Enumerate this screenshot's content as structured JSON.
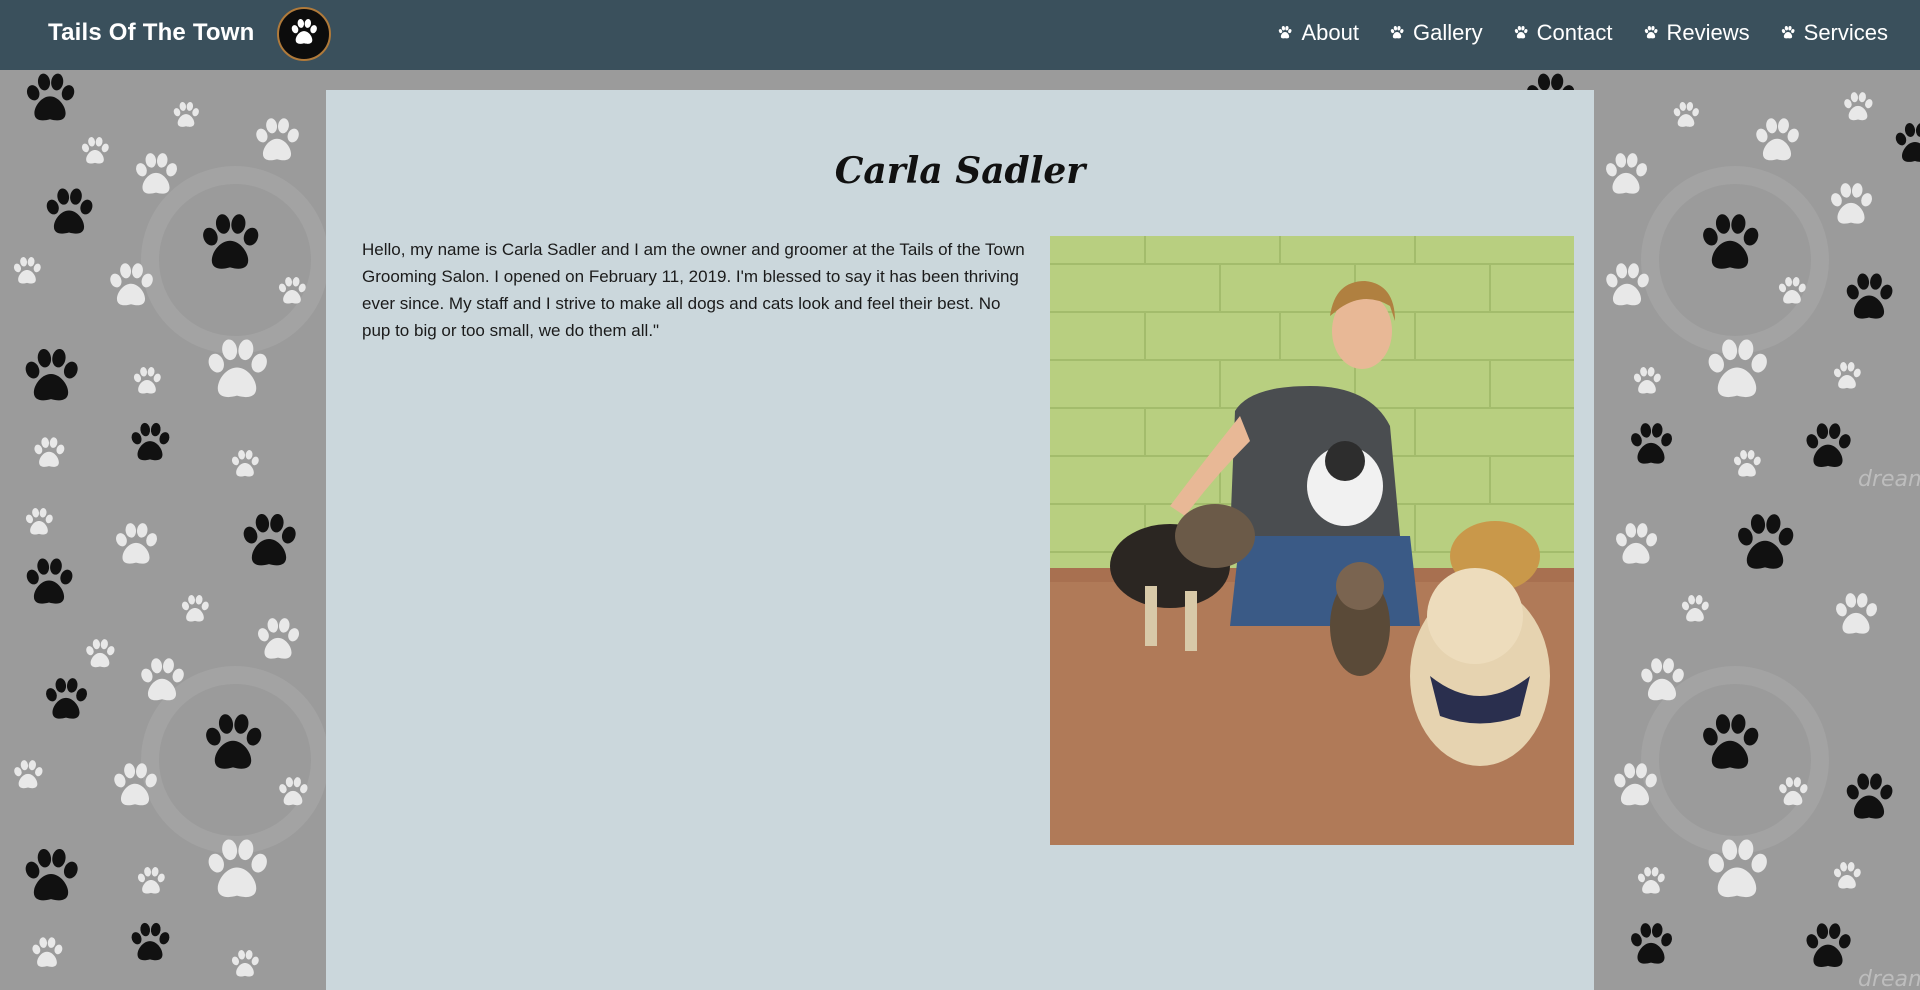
{
  "navbar": {
    "brand": "Tails Of The Town",
    "logo_icon": "paw-logo-icon",
    "links": [
      {
        "label": "About",
        "icon": "paw-icon"
      },
      {
        "label": "Gallery",
        "icon": "paw-icon"
      },
      {
        "label": "Contact",
        "icon": "paw-icon"
      },
      {
        "label": "Reviews",
        "icon": "paw-icon"
      },
      {
        "label": "Services",
        "icon": "paw-icon"
      }
    ]
  },
  "page": {
    "title": "Carla Sadler",
    "bio": "Hello, my name is Carla Sadler and I am the owner and groomer at the Tails of the Town Grooming Salon. I opened on February 11, 2019. I'm blessed to say it has been thriving ever since. My staff and I strive to make all dogs and cats look and feel their best. No pup to big or too small, we do them all.\""
  },
  "background": {
    "watermark": "dreamstime"
  },
  "colors": {
    "navbar": "#3a505c",
    "content_bg": "#cbd7dc",
    "page_bg": "#9b9b9b"
  }
}
